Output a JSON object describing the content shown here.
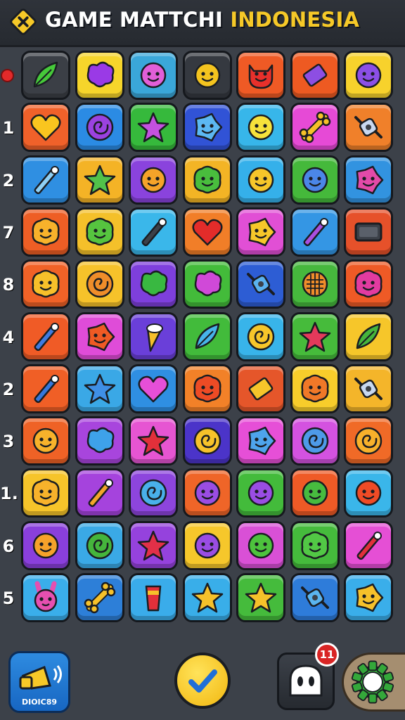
{
  "header": {
    "title_white": "GAME MATTCHI",
    "title_yellow": "INDONESIA",
    "logo_icon": "x-diamond-icon"
  },
  "row_labels": [
    "",
    "1",
    "2",
    "7",
    "8",
    "4",
    "2",
    "3",
    "1.",
    "6",
    "5"
  ],
  "grid": {
    "rows": [
      [
        {
          "color": "#3b3f46",
          "icon": "leaf-icon",
          "fg": "#46c93a"
        },
        {
          "color": "#f6d52b",
          "icon": "heart-blob-icon",
          "fg": "#9a3ae6"
        },
        {
          "color": "#3aa7d9",
          "icon": "smiley-icon",
          "fg": "#e25fd8"
        },
        {
          "color": "#353940",
          "icon": "smiley-icon",
          "fg": "#f4c41f"
        },
        {
          "color": "#ef5a25",
          "icon": "devil-face-icon",
          "fg": "#e8302b"
        },
        {
          "color": "#ee5a22",
          "icon": "diamond-icon",
          "fg": "#8d4ee3"
        },
        {
          "color": "#f7d22c",
          "icon": "smiley-icon",
          "fg": "#8b4fe6"
        }
      ],
      [
        {
          "color": "#f0612a",
          "icon": "heart-icon",
          "fg": "#f9c51f"
        },
        {
          "color": "#2b8be4",
          "icon": "swirl-icon",
          "fg": "#9b42e0"
        },
        {
          "color": "#36b93c",
          "icon": "star-icon",
          "fg": "#c451e0"
        },
        {
          "color": "#3153d6",
          "icon": "gear-face-icon",
          "fg": "#5cb8f2"
        },
        {
          "color": "#37b6ea",
          "icon": "smiley-icon",
          "fg": "#f6e23b"
        },
        {
          "color": "#e64ad6",
          "icon": "bone-icon",
          "fg": "#f6c129"
        },
        {
          "color": "#f0802a",
          "icon": "candy-icon",
          "fg": "#c8d8f0"
        }
      ],
      [
        {
          "color": "#2f8fe2",
          "icon": "wand-icon",
          "fg": "#8fd0f5"
        },
        {
          "color": "#f4b326",
          "icon": "star-icon",
          "fg": "#52c24a"
        },
        {
          "color": "#8a43dd",
          "icon": "smiley-icon",
          "fg": "#f5a329"
        },
        {
          "color": "#f3b425",
          "icon": "blob-face-icon",
          "fg": "#49bd3d"
        },
        {
          "color": "#35b0ea",
          "icon": "smiley-icon",
          "fg": "#f6c62a"
        },
        {
          "color": "#45b93b",
          "icon": "smiley-icon",
          "fg": "#4b86e7"
        },
        {
          "color": "#3293e0",
          "icon": "gear-face-icon",
          "fg": "#e34aa8"
        }
      ],
      [
        {
          "color": "#ee5e25",
          "icon": "blob-face-icon",
          "fg": "#f7b22b"
        },
        {
          "color": "#f4c02a",
          "icon": "blob-face-icon",
          "fg": "#56c43f"
        },
        {
          "color": "#3ab7ea",
          "icon": "wand-icon",
          "fg": "#3c4149"
        },
        {
          "color": "#f17e28",
          "icon": "heart-icon",
          "fg": "#e32c2a"
        },
        {
          "color": "#e14fd5",
          "icon": "gear-face-icon",
          "fg": "#f6c72a"
        },
        {
          "color": "#3496e4",
          "icon": "wand-icon",
          "fg": "#a94fe0"
        },
        {
          "color": "#e6512a",
          "icon": "screen-icon",
          "fg": "#3c4149"
        }
      ],
      [
        {
          "color": "#f06227",
          "icon": "blob-face-icon",
          "fg": "#f7c02a"
        },
        {
          "color": "#f6c22a",
          "icon": "swirl-icon",
          "fg": "#ef8d2a"
        },
        {
          "color": "#7e3fdc",
          "icon": "heart-blob-icon",
          "fg": "#39b841"
        },
        {
          "color": "#43bb3a",
          "icon": "heart-blob-icon",
          "fg": "#d049d8"
        },
        {
          "color": "#2d5dd4",
          "icon": "candy-icon",
          "fg": "#5ab2ef"
        },
        {
          "color": "#46b83d",
          "icon": "waffle-icon",
          "fg": "#ef8d2a"
        },
        {
          "color": "#ee5a26",
          "icon": "blob-face-icon",
          "fg": "#e23ba0"
        }
      ],
      [
        {
          "color": "#f05b26",
          "icon": "wand-icon",
          "fg": "#3f7be0"
        },
        {
          "color": "#df4cd8",
          "icon": "gear-face-icon",
          "fg": "#ef5a24"
        },
        {
          "color": "#6a3fd9",
          "icon": "cone-icon",
          "fg": "#f6c02a"
        },
        {
          "color": "#42bb3b",
          "icon": "leaf-icon",
          "fg": "#47b4ea"
        },
        {
          "color": "#38b4ea",
          "icon": "swirl-icon",
          "fg": "#f6c62a"
        },
        {
          "color": "#46bb3b",
          "icon": "star-icon",
          "fg": "#e5395b"
        },
        {
          "color": "#f6c62a",
          "icon": "leaf-icon",
          "fg": "#46b53c"
        }
      ],
      [
        {
          "color": "#f05f26",
          "icon": "wand-icon",
          "fg": "#3578dc"
        },
        {
          "color": "#3aa8e6",
          "icon": "star-icon",
          "fg": "#3f8fe6"
        },
        {
          "color": "#2f8fe2",
          "icon": "heart-icon",
          "fg": "#e64fd8"
        },
        {
          "color": "#f28128",
          "icon": "blob-face-icon",
          "fg": "#ed4b25"
        },
        {
          "color": "#e5562a",
          "icon": "diamond-icon",
          "fg": "#f6c62a"
        },
        {
          "color": "#f7cd2b",
          "icon": "blob-face-icon",
          "fg": "#f07828"
        },
        {
          "color": "#f4b52a",
          "icon": "candy-icon",
          "fg": "#c8d8f0"
        }
      ],
      [
        {
          "color": "#ef6226",
          "icon": "smiley-icon",
          "fg": "#f7b22b"
        },
        {
          "color": "#a845dd",
          "icon": "heart-blob-icon",
          "fg": "#3ea2ea"
        },
        {
          "color": "#e655d2",
          "icon": "star-icon",
          "fg": "#e2303a"
        },
        {
          "color": "#4b34c9",
          "icon": "swirl-icon",
          "fg": "#f6c22a"
        },
        {
          "color": "#e64fd7",
          "icon": "gear-face-icon",
          "fg": "#4ea4ec"
        },
        {
          "color": "#d452e0",
          "icon": "swirl-icon",
          "fg": "#4e9ae8"
        },
        {
          "color": "#f06a27",
          "icon": "swirl-icon",
          "fg": "#f7b12b"
        }
      ],
      [
        {
          "color": "#f6c42a",
          "icon": "blob-face-icon",
          "fg": "#f7b22b"
        },
        {
          "color": "#a543dd",
          "icon": "wand-icon",
          "fg": "#f3a52a"
        },
        {
          "color": "#8d45dd",
          "icon": "swirl-icon",
          "fg": "#49b0ea"
        },
        {
          "color": "#ef6528",
          "icon": "smiley-icon",
          "fg": "#9a4de3"
        },
        {
          "color": "#43bb3b",
          "icon": "smiley-icon",
          "fg": "#9a4de3"
        },
        {
          "color": "#ef5a26",
          "icon": "smiley-icon",
          "fg": "#47bb3f"
        },
        {
          "color": "#3ab6ea",
          "icon": "smiley-icon",
          "fg": "#ef4b26"
        }
      ],
      [
        {
          "color": "#8a3fdc",
          "icon": "smiley-icon",
          "fg": "#f6a22a"
        },
        {
          "color": "#3aa9e6",
          "icon": "swirl-icon",
          "fg": "#45b53c"
        },
        {
          "color": "#9542dd",
          "icon": "star-icon",
          "fg": "#e23048"
        },
        {
          "color": "#f6c72b",
          "icon": "smiley-icon",
          "fg": "#9a4de3"
        },
        {
          "color": "#d950d6",
          "icon": "smiley-icon",
          "fg": "#4dc23d"
        },
        {
          "color": "#45bb3c",
          "icon": "blob-face-icon",
          "fg": "#52c845"
        },
        {
          "color": "#e54fd5",
          "icon": "wand-icon",
          "fg": "#e2303a"
        }
      ],
      [
        {
          "color": "#3aaeea",
          "icon": "bunny-face-icon",
          "fg": "#e64fb0"
        },
        {
          "color": "#2d7fd8",
          "icon": "bone-icon",
          "fg": "#f6c12a"
        },
        {
          "color": "#3aacea",
          "icon": "cup-icon",
          "fg": "#e2303a"
        },
        {
          "color": "#39aee9",
          "icon": "star-icon",
          "fg": "#f6c12a"
        },
        {
          "color": "#45bb3c",
          "icon": "star-icon",
          "fg": "#f6c12a"
        },
        {
          "color": "#2e7cda",
          "icon": "candy-icon",
          "fg": "#5ab4ef"
        },
        {
          "color": "#3aaeea",
          "icon": "gear-face-icon",
          "fg": "#f6c12a"
        }
      ]
    ]
  },
  "bottom": {
    "daily_label": "DIOIC89",
    "daily_icon": "megaphone-icon",
    "confirm_icon": "checkmark-icon",
    "avatar_icon": "ghost-face-icon",
    "notification_count": "11",
    "settings_icon": "gear-icon"
  }
}
